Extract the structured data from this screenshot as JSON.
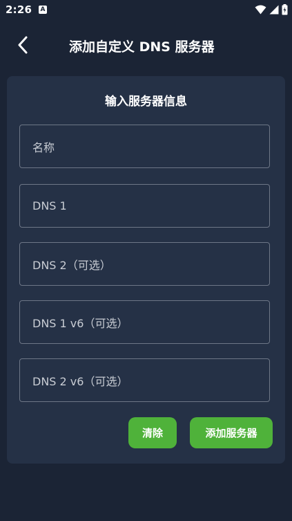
{
  "status_bar": {
    "time": "2:26",
    "notification_icon": "a-icon"
  },
  "header": {
    "title": "添加自定义 DNS 服务器",
    "back_icon": "chevron-left-icon"
  },
  "form": {
    "title": "输入服务器信息",
    "fields": [
      {
        "placeholder": "名称",
        "value": ""
      },
      {
        "placeholder": "DNS 1",
        "value": ""
      },
      {
        "placeholder": "DNS 2（可选）",
        "value": ""
      },
      {
        "placeholder": "DNS 1 v6（可选）",
        "value": ""
      },
      {
        "placeholder": "DNS 2 v6（可选）",
        "value": ""
      }
    ],
    "clear_label": "清除",
    "add_label": "添加服务器"
  },
  "colors": {
    "background": "#1b2435",
    "card": "#253146",
    "accent": "#4fb23a",
    "field_border": "#6e7787"
  }
}
